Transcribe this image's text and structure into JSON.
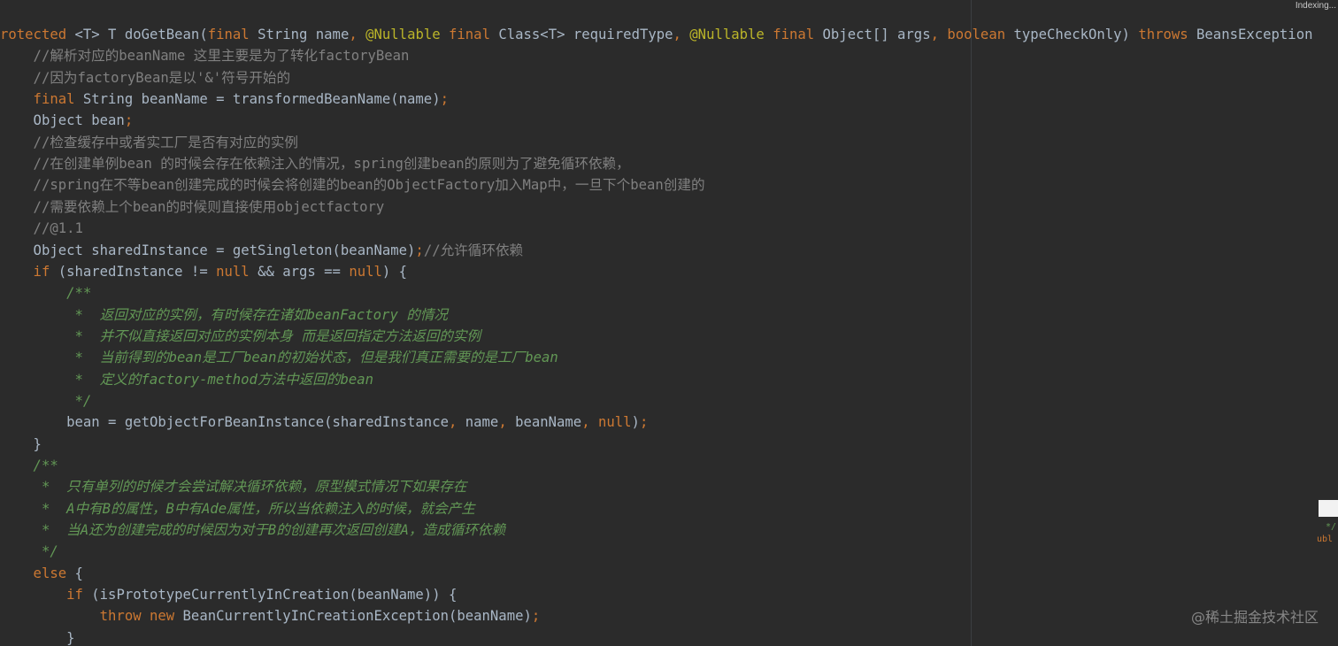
{
  "status": {
    "indexing": "Indexing..."
  },
  "code_lines": [
    [
      {
        "t": "rotected ",
        "c": "kw"
      },
      {
        "t": "<T> T doGetBean(",
        "c": "pl"
      },
      {
        "t": "final ",
        "c": "kw"
      },
      {
        "t": "String name",
        "c": "pl"
      },
      {
        "t": ", ",
        "c": "kw"
      },
      {
        "t": "@Nullable ",
        "c": "an"
      },
      {
        "t": "final ",
        "c": "kw"
      },
      {
        "t": "Class<T> requiredType",
        "c": "pl"
      },
      {
        "t": ", ",
        "c": "kw"
      },
      {
        "t": "@Nullable ",
        "c": "an"
      },
      {
        "t": "final ",
        "c": "kw"
      },
      {
        "t": "Object[] args",
        "c": "pl"
      },
      {
        "t": ", ",
        "c": "kw"
      },
      {
        "t": "boolean ",
        "c": "kw"
      },
      {
        "t": "typeCheckOnly) ",
        "c": "pl"
      },
      {
        "t": "throws ",
        "c": "kw"
      },
      {
        "t": "BeansException",
        "c": "pl"
      }
    ],
    [
      {
        "t": "    //解析对应的beanName 这里主要是为了转化factoryBean",
        "c": "cm"
      }
    ],
    [
      {
        "t": "    //因为factoryBean是以'&'符号开始的",
        "c": "cm"
      }
    ],
    [
      {
        "t": "    final ",
        "c": "kw"
      },
      {
        "t": "String beanName = transformedBeanName(name)",
        "c": "pl"
      },
      {
        "t": ";",
        "c": "kw"
      }
    ],
    [
      {
        "t": "    Object bean",
        "c": "pl"
      },
      {
        "t": ";",
        "c": "kw"
      }
    ],
    [
      {
        "t": "    //检查缓存中或者实工厂是否有对应的实例",
        "c": "cm"
      }
    ],
    [
      {
        "t": "    //在创建单例bean 的时候会存在依赖注入的情况，spring创建bean的原则为了避免循环依赖，",
        "c": "cm"
      }
    ],
    [
      {
        "t": "    //spring在不等bean创建完成的时候会将创建的bean的ObjectFactory加入Map中，一旦下个bean创建的",
        "c": "cm"
      }
    ],
    [
      {
        "t": "    //需要依赖上个bean的时候则直接使用objectfactory",
        "c": "cm"
      }
    ],
    [
      {
        "t": "    //@1.1",
        "c": "cm"
      }
    ],
    [
      {
        "t": "    Object sharedInstance = getSingleton(beanName)",
        "c": "pl"
      },
      {
        "t": ";",
        "c": "kw"
      },
      {
        "t": "//允许循环依赖",
        "c": "cm"
      }
    ],
    [
      {
        "t": "    if ",
        "c": "kw"
      },
      {
        "t": "(sharedInstance != ",
        "c": "pl"
      },
      {
        "t": "null ",
        "c": "kw"
      },
      {
        "t": "&& args == ",
        "c": "pl"
      },
      {
        "t": "null",
        "c": "kw"
      },
      {
        "t": ") {",
        "c": "pl"
      }
    ],
    [
      {
        "t": "        /**",
        "c": "doc"
      }
    ],
    [
      {
        "t": "         *  返回对应的实例，有时候存在诸如beanFactory 的情况",
        "c": "doc"
      }
    ],
    [
      {
        "t": "         *  并不似直接返回对应的实例本身 而是返回指定方法返回的实例",
        "c": "doc"
      }
    ],
    [
      {
        "t": "         *  当前得到的bean是工厂bean的初始状态，但是我们真正需要的是工厂bean",
        "c": "doc"
      }
    ],
    [
      {
        "t": "         *  定义的factory-method方法中返回的bean",
        "c": "doc"
      }
    ],
    [
      {
        "t": "         */",
        "c": "doc"
      }
    ],
    [
      {
        "t": "        bean = getObjectForBeanInstance(sharedInstance",
        "c": "pl"
      },
      {
        "t": ", ",
        "c": "kw"
      },
      {
        "t": "name",
        "c": "pl"
      },
      {
        "t": ", ",
        "c": "kw"
      },
      {
        "t": "beanName",
        "c": "pl"
      },
      {
        "t": ", ",
        "c": "kw"
      },
      {
        "t": "null",
        "c": "kw"
      },
      {
        "t": ")",
        "c": "pl"
      },
      {
        "t": ";",
        "c": "kw"
      }
    ],
    [
      {
        "t": "    }",
        "c": "pl"
      }
    ],
    [
      {
        "t": "    /**",
        "c": "doc"
      }
    ],
    [
      {
        "t": "     *  只有单列的时候才会尝试解决循环依赖，原型模式情况下如果存在",
        "c": "doc"
      }
    ],
    [
      {
        "t": "     *  A中有B的属性，B中有Ade属性，所以当依赖注入的时候，就会产生",
        "c": "doc"
      }
    ],
    [
      {
        "t": "     *  当A还为创建完成的时候因为对于B的创建再次返回创建A，造成循环依赖",
        "c": "doc"
      }
    ],
    [
      {
        "t": "     */",
        "c": "doc"
      }
    ],
    [
      {
        "t": "    else ",
        "c": "kw"
      },
      {
        "t": "{",
        "c": "pl"
      }
    ],
    [
      {
        "t": "        if ",
        "c": "kw"
      },
      {
        "t": "(isPrototypeCurrentlyInCreation(beanName)) {",
        "c": "pl"
      }
    ],
    [
      {
        "t": "            throw new ",
        "c": "kw"
      },
      {
        "t": "BeanCurrentlyInCreationException(beanName)",
        "c": "pl"
      },
      {
        "t": ";",
        "c": "kw"
      }
    ],
    [
      {
        "t": "        }",
        "c": "pl"
      }
    ]
  ],
  "peek_panel": {
    "line1": " */",
    "line2": "ubl"
  },
  "watermark": "@稀土掘金技术社区",
  "colors": {
    "background": "#2b2b2b",
    "plain": "#a9b7c6",
    "keyword": "#cc7832",
    "comment": "#808080",
    "doc_comment": "#629755",
    "annotation": "#bbb529"
  }
}
